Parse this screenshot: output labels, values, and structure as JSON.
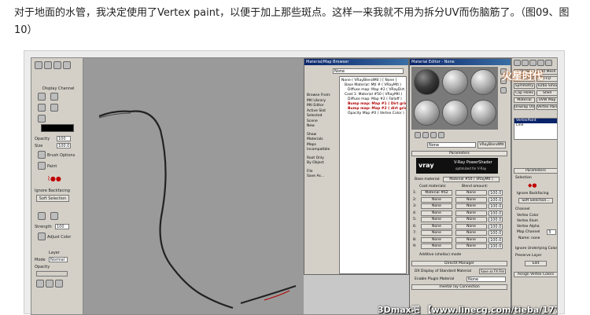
{
  "article": {
    "paragraph": "对于地面的水管，我决定使用了Vertex paint，以便于加上那些斑点。这样一来我就不用为拆分UV而伤脑筋了。（图09、图10）"
  },
  "left_panel": {
    "title": "Display Channel",
    "opacity_label": "Opacity",
    "opacity_value": "100",
    "size_label": "Size",
    "size_value": "100.0",
    "brush_options": "Brush Options",
    "paint_label": "Paint",
    "ignore_backfacing": "Ignore Backfacing",
    "soft_selection": "Soft Selection",
    "strength_label": "Strength",
    "strength_value": "100",
    "adjust_color": "Adjust Color",
    "layer_label": "Layer",
    "mode_label": "Mode",
    "mode_value": "Normal",
    "opacity2_label": "Opacity"
  },
  "material_browser": {
    "title": "Material/Map Browser",
    "search_value": "None",
    "browse_from_title": "Browse From:",
    "browse_options": [
      "Mtl Library",
      "Mtl Editor",
      "Active Slot",
      "Selected",
      "Scene",
      "New"
    ],
    "show_title": "Show",
    "show_options": [
      "Materials",
      "Maps",
      "Incompatible"
    ],
    "root_only": "Root Only",
    "by_object": "By Object",
    "file_title": "File",
    "save_as": "Save As...",
    "tree": [
      "None ( VRayBlendMtl ) [ None ]",
      "Base Material: Mtl # ( VRayMtl )",
      "Diffuse map: Map #2 ( VRayDirt )",
      "Coat 1: Material #50 ( VRayMtl )",
      "Diffuse map: Map #2 ( Falloff )",
      "Bump map: Map #1 ( Dirt grid )",
      "Bump map: Map #2 ( dirt grid )",
      "Opacity Map #0 ( Vertex Color )"
    ]
  },
  "material_editor": {
    "title": "Material Editor - None",
    "material_name": "None",
    "material_type": "VRayBlendMtl",
    "parameters_label": "Parameters",
    "vray_logo": "vray",
    "vray_title": "V-Ray PowerShader",
    "vray_subtitle": "optimized for V-Ray",
    "base_material_label": "Base material:",
    "base_material_value": "Material #50 ( VRayMtl )",
    "coat_label": "Coat materials:",
    "blend_label": "Blend amount:",
    "coat_rows": [
      {
        "n": "1:",
        "mat": "Material #62",
        "map": "None",
        "amt": "100.0"
      },
      {
        "n": "2:",
        "mat": "None",
        "map": "None",
        "amt": "100.0"
      },
      {
        "n": "3:",
        "mat": "None",
        "map": "None",
        "amt": "100.0"
      },
      {
        "n": "4:",
        "mat": "None",
        "map": "None",
        "amt": "100.0"
      },
      {
        "n": "5:",
        "mat": "None",
        "map": "None",
        "amt": "100.0"
      },
      {
        "n": "6:",
        "mat": "None",
        "map": "None",
        "amt": "100.0"
      },
      {
        "n": "7:",
        "mat": "None",
        "map": "None",
        "amt": "100.0"
      },
      {
        "n": "8:",
        "mat": "None",
        "map": "None",
        "amt": "100.0"
      },
      {
        "n": "9:",
        "mat": "None",
        "map": "None",
        "amt": "100.0"
      }
    ],
    "additive_label": "Additive (shellac) mode",
    "dx_manager": "DirectX Manager",
    "dx_enable": "DX Display of Standard Material",
    "save_fx": "Save as FX File",
    "enable_plugin": "Enable Plugin Material",
    "plugin_value": "None",
    "mental_ray": "mental ray Connection"
  },
  "command_panel": {
    "buttons": [
      "Edit Poly",
      "MeshSmooth",
      "Symmetry",
      "Cap Holes",
      "Material",
      "Unwrap UVW",
      "Edit Mesh",
      "FFD",
      "Turbo Smooth",
      "Shell",
      "UVW Map",
      "Vertex Paint"
    ],
    "stack_items": [
      "VertexPaint",
      "Line"
    ],
    "parameters_label": "Parameters",
    "selection_label": "Selection",
    "ignore_backfacing": "Ignore Backfacing",
    "soft_selection": "Soft Selection...",
    "channel_label": "Channel",
    "channel_options": [
      "Vertex Color",
      "Vertex Illum",
      "Vertex Alpha",
      "Map Channel"
    ],
    "map_value": "3",
    "name_label": "Name: none",
    "ignore_underlying": "Ignore Underlying Color",
    "preserve_layer": "Preserve Layer",
    "edit_btn": "Edit",
    "assign_label": "Assign Vertex Colors"
  },
  "watermark": "3Dmax吧 【www.linecg.com/tieba/1771】",
  "logo": "火星时代"
}
